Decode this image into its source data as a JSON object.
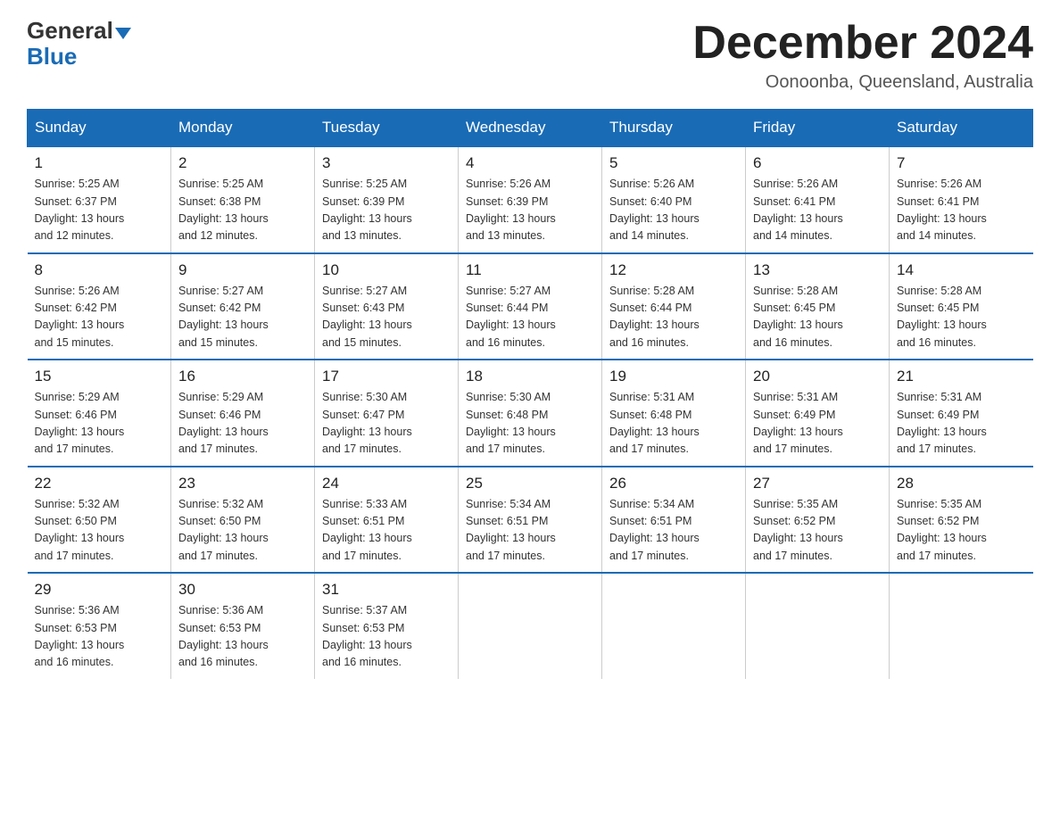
{
  "header": {
    "logo_general": "General",
    "logo_blue": "Blue",
    "month_title": "December 2024",
    "subtitle": "Oonoonba, Queensland, Australia"
  },
  "weekdays": [
    "Sunday",
    "Monday",
    "Tuesday",
    "Wednesday",
    "Thursday",
    "Friday",
    "Saturday"
  ],
  "weeks": [
    [
      {
        "day": "1",
        "sunrise": "5:25 AM",
        "sunset": "6:37 PM",
        "daylight": "13 hours and 12 minutes."
      },
      {
        "day": "2",
        "sunrise": "5:25 AM",
        "sunset": "6:38 PM",
        "daylight": "13 hours and 12 minutes."
      },
      {
        "day": "3",
        "sunrise": "5:25 AM",
        "sunset": "6:39 PM",
        "daylight": "13 hours and 13 minutes."
      },
      {
        "day": "4",
        "sunrise": "5:26 AM",
        "sunset": "6:39 PM",
        "daylight": "13 hours and 13 minutes."
      },
      {
        "day": "5",
        "sunrise": "5:26 AM",
        "sunset": "6:40 PM",
        "daylight": "13 hours and 14 minutes."
      },
      {
        "day": "6",
        "sunrise": "5:26 AM",
        "sunset": "6:41 PM",
        "daylight": "13 hours and 14 minutes."
      },
      {
        "day": "7",
        "sunrise": "5:26 AM",
        "sunset": "6:41 PM",
        "daylight": "13 hours and 14 minutes."
      }
    ],
    [
      {
        "day": "8",
        "sunrise": "5:26 AM",
        "sunset": "6:42 PM",
        "daylight": "13 hours and 15 minutes."
      },
      {
        "day": "9",
        "sunrise": "5:27 AM",
        "sunset": "6:42 PM",
        "daylight": "13 hours and 15 minutes."
      },
      {
        "day": "10",
        "sunrise": "5:27 AM",
        "sunset": "6:43 PM",
        "daylight": "13 hours and 15 minutes."
      },
      {
        "day": "11",
        "sunrise": "5:27 AM",
        "sunset": "6:44 PM",
        "daylight": "13 hours and 16 minutes."
      },
      {
        "day": "12",
        "sunrise": "5:28 AM",
        "sunset": "6:44 PM",
        "daylight": "13 hours and 16 minutes."
      },
      {
        "day": "13",
        "sunrise": "5:28 AM",
        "sunset": "6:45 PM",
        "daylight": "13 hours and 16 minutes."
      },
      {
        "day": "14",
        "sunrise": "5:28 AM",
        "sunset": "6:45 PM",
        "daylight": "13 hours and 16 minutes."
      }
    ],
    [
      {
        "day": "15",
        "sunrise": "5:29 AM",
        "sunset": "6:46 PM",
        "daylight": "13 hours and 17 minutes."
      },
      {
        "day": "16",
        "sunrise": "5:29 AM",
        "sunset": "6:46 PM",
        "daylight": "13 hours and 17 minutes."
      },
      {
        "day": "17",
        "sunrise": "5:30 AM",
        "sunset": "6:47 PM",
        "daylight": "13 hours and 17 minutes."
      },
      {
        "day": "18",
        "sunrise": "5:30 AM",
        "sunset": "6:48 PM",
        "daylight": "13 hours and 17 minutes."
      },
      {
        "day": "19",
        "sunrise": "5:31 AM",
        "sunset": "6:48 PM",
        "daylight": "13 hours and 17 minutes."
      },
      {
        "day": "20",
        "sunrise": "5:31 AM",
        "sunset": "6:49 PM",
        "daylight": "13 hours and 17 minutes."
      },
      {
        "day": "21",
        "sunrise": "5:31 AM",
        "sunset": "6:49 PM",
        "daylight": "13 hours and 17 minutes."
      }
    ],
    [
      {
        "day": "22",
        "sunrise": "5:32 AM",
        "sunset": "6:50 PM",
        "daylight": "13 hours and 17 minutes."
      },
      {
        "day": "23",
        "sunrise": "5:32 AM",
        "sunset": "6:50 PM",
        "daylight": "13 hours and 17 minutes."
      },
      {
        "day": "24",
        "sunrise": "5:33 AM",
        "sunset": "6:51 PM",
        "daylight": "13 hours and 17 minutes."
      },
      {
        "day": "25",
        "sunrise": "5:34 AM",
        "sunset": "6:51 PM",
        "daylight": "13 hours and 17 minutes."
      },
      {
        "day": "26",
        "sunrise": "5:34 AM",
        "sunset": "6:51 PM",
        "daylight": "13 hours and 17 minutes."
      },
      {
        "day": "27",
        "sunrise": "5:35 AM",
        "sunset": "6:52 PM",
        "daylight": "13 hours and 17 minutes."
      },
      {
        "day": "28",
        "sunrise": "5:35 AM",
        "sunset": "6:52 PM",
        "daylight": "13 hours and 17 minutes."
      }
    ],
    [
      {
        "day": "29",
        "sunrise": "5:36 AM",
        "sunset": "6:53 PM",
        "daylight": "13 hours and 16 minutes."
      },
      {
        "day": "30",
        "sunrise": "5:36 AM",
        "sunset": "6:53 PM",
        "daylight": "13 hours and 16 minutes."
      },
      {
        "day": "31",
        "sunrise": "5:37 AM",
        "sunset": "6:53 PM",
        "daylight": "13 hours and 16 minutes."
      },
      null,
      null,
      null,
      null
    ]
  ],
  "labels": {
    "sunrise": "Sunrise:",
    "sunset": "Sunset:",
    "daylight": "Daylight:"
  }
}
